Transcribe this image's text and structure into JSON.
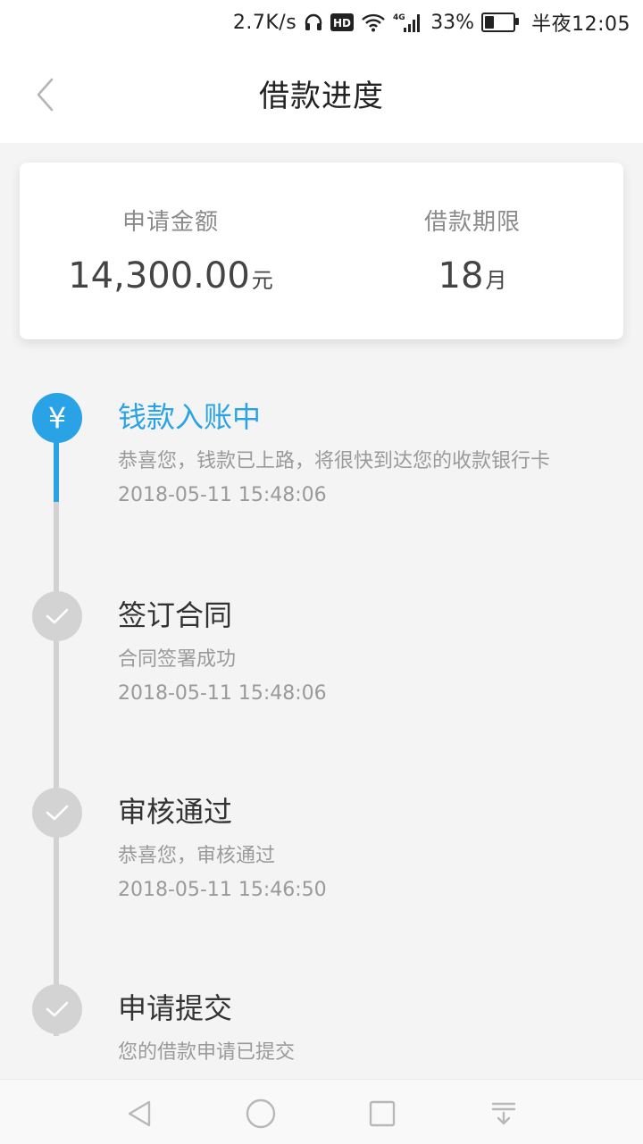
{
  "status_bar": {
    "net_speed": "2.7K/s",
    "hd_label": "HD",
    "network_type": "4G",
    "battery_percent": "33%",
    "battery_level": 33,
    "time": "半夜12:05",
    "icons": [
      "headphones-icon",
      "hd-icon",
      "wifi-icon",
      "signal-icon",
      "battery-icon"
    ]
  },
  "header": {
    "title": "借款进度",
    "back_icon": "chevron-left-icon"
  },
  "summary": {
    "amount_label": "申请金额",
    "amount_value": "14,300.00",
    "amount_unit": "元",
    "term_label": "借款期限",
    "term_value": "18",
    "term_unit": "月"
  },
  "steps": [
    {
      "title": "钱款入账中",
      "description": "恭喜您，钱款已上路，将很快到达您的收款银行卡",
      "time": "2018-05-11 15:48:06",
      "status": "active",
      "icon": "yuan-icon",
      "icon_text": "¥"
    },
    {
      "title": "签订合同",
      "description": "合同签署成功",
      "time": "2018-05-11 15:48:06",
      "status": "done",
      "icon": "check-icon"
    },
    {
      "title": "审核通过",
      "description": "恭喜您，审核通过",
      "time": "2018-05-11 15:46:50",
      "status": "done",
      "icon": "check-icon"
    },
    {
      "title": "申请提交",
      "description": "您的借款申请已提交",
      "status": "done",
      "icon": "check-icon"
    }
  ],
  "navbar": {
    "icons": [
      "nav-back-icon",
      "nav-home-icon",
      "nav-recent-icon",
      "nav-notification-icon"
    ]
  },
  "colors": {
    "accent": "#2aa3e6",
    "inactive": "#d3d3d3"
  }
}
